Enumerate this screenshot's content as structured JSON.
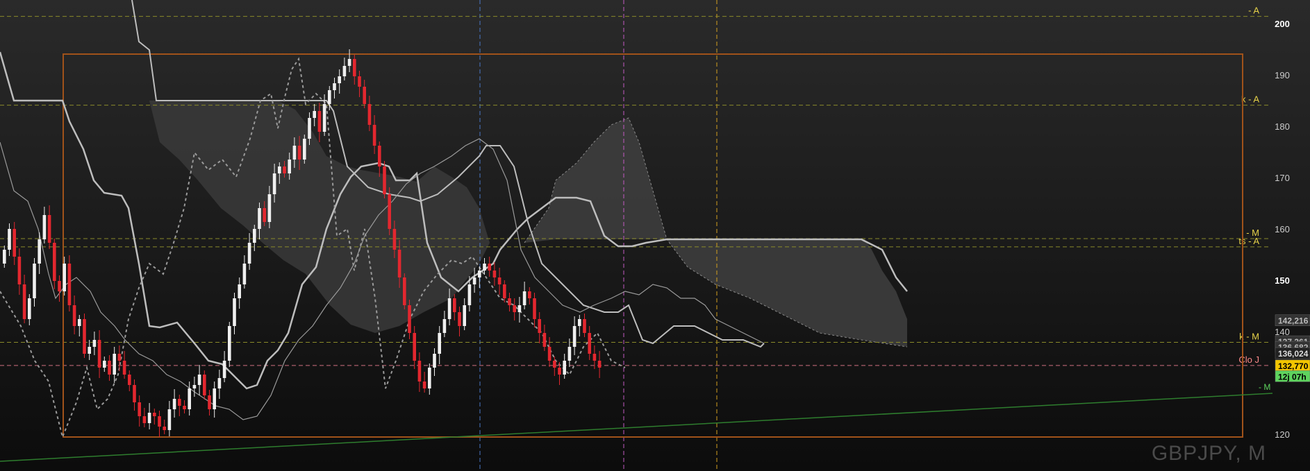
{
  "chart_data": {
    "type": "candlestick",
    "symbol": "GBPJPY, M",
    "y_axis": {
      "min": 115,
      "max": 203,
      "ticks": [
        120,
        140,
        150,
        160,
        170,
        180,
        190,
        200
      ]
    },
    "level_lines": [
      {
        "label": "- A",
        "value": 201.4,
        "color": "#8a8a2a",
        "label_color": "#e6d24a"
      },
      {
        "label": "k - A",
        "value": 184.1,
        "color": "#8a8a2a",
        "label_color": "#e6d24a"
      },
      {
        "label": "- M",
        "value": 158.1,
        "color": "#8a8a2a",
        "label_color": "#e6d24a"
      },
      {
        "label": "ts - A",
        "value": 156.5,
        "color": "#8a8a2a",
        "label_color": "#e6d24a"
      },
      {
        "label": "k - M",
        "value": 137.9,
        "color": "#8a8a2a",
        "label_color": "#e6d24a"
      },
      {
        "label": "Clo J",
        "value": 133.4,
        "color": "#d07080",
        "label_color": "#ff8a8a"
      }
    ],
    "trendline_label": "- M",
    "price_tags": [
      {
        "text": "142,216",
        "value": 142.2,
        "bg": "#333333",
        "fg": "#bbbbbb"
      },
      {
        "text": "137,361",
        "value": 138.1,
        "bg": "#333333",
        "fg": "#bbbbbb"
      },
      {
        "text": "136,682",
        "value": 137.0,
        "bg": "#333333",
        "fg": "#bbbbbb"
      },
      {
        "text": "136,024",
        "value": 135.8,
        "bg": "#222222",
        "fg": "#dddddd"
      },
      {
        "text": "132,770",
        "value": 133.4,
        "bg": "#f2c500",
        "fg": "#000000"
      },
      {
        "text": "12j 07h",
        "value": 131.3,
        "bg": "#5ed35e",
        "fg": "#000000"
      }
    ],
    "colors": {
      "up": "#f0f0f0",
      "down": "#e3272f",
      "box": "#a0521a",
      "trend": "#2e7d2e",
      "grid": "#8a8a2a",
      "axis_text": "#cccccc"
    }
  },
  "watermark": "GBPJPY, M"
}
